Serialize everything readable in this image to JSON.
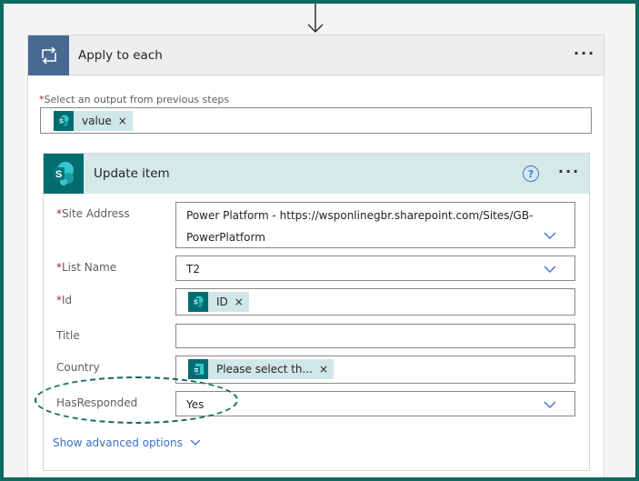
{
  "apply_to_each": {
    "title": "Apply to each",
    "menu": "···",
    "select_label_req": "*",
    "select_label": "Select an output from previous steps",
    "token_value": "value",
    "token_remove": "×"
  },
  "update_item": {
    "title": "Update item",
    "help": "?",
    "menu": "···",
    "fields": {
      "site_address": {
        "req": "*",
        "label": "Site Address",
        "value_line1": "Power Platform - https://wsponlinegbr.sharepoint.com/Sites/GB-",
        "value_line2": "PowerPlatform"
      },
      "list_name": {
        "req": "*",
        "label": "List Name",
        "value": "T2"
      },
      "id": {
        "req": "*",
        "label": "Id",
        "token": "ID",
        "token_remove": "×"
      },
      "title": {
        "label": "Title",
        "value": ""
      },
      "country": {
        "label": "Country",
        "token": "Please select th...",
        "token_remove": "×"
      },
      "has_responded": {
        "label": "HasResponded",
        "value": "Yes"
      }
    },
    "advanced_link": "Show advanced options"
  },
  "colors": {
    "frame": "#0d6b5f",
    "apply_icon_bg": "#486991",
    "sharepoint": "#036c70",
    "token_bg": "#d0e7e8",
    "link": "#3a73c4"
  }
}
